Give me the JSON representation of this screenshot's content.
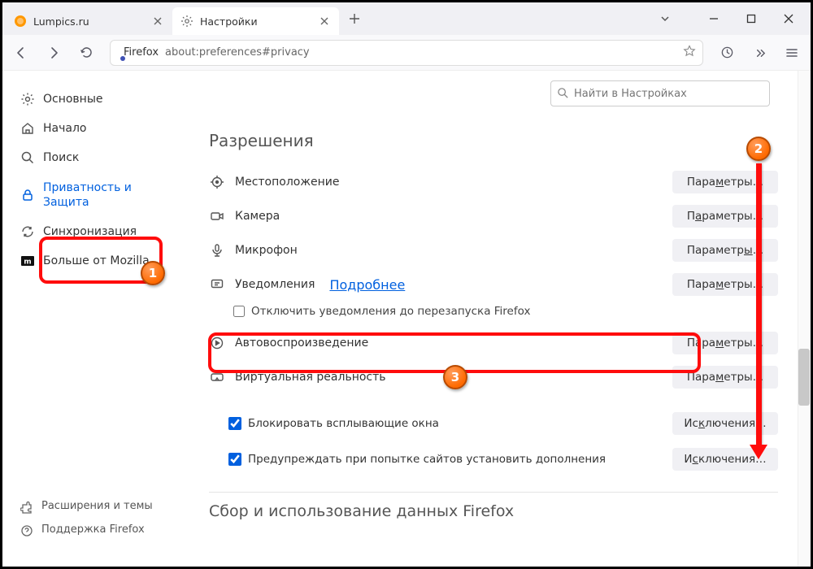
{
  "tabs": [
    {
      "title": "Lumpics.ru",
      "icon": "orange"
    },
    {
      "title": "Настройки",
      "icon": "gear"
    }
  ],
  "urlbar": {
    "brand": "Firefox",
    "address": "about:preferences#privacy"
  },
  "search": {
    "placeholder": "Найти в Настройках"
  },
  "sidebar": {
    "items": [
      {
        "label": "Основные"
      },
      {
        "label": "Начало"
      },
      {
        "label": "Поиск"
      },
      {
        "label": "Приватность и Защита"
      },
      {
        "label": "Синхронизация"
      },
      {
        "label": "Больше от Mozilla"
      }
    ],
    "bottom": [
      {
        "label": "Расширения и темы"
      },
      {
        "label": "Поддержка Firefox"
      }
    ]
  },
  "main": {
    "heading": "Разрешения",
    "perms": [
      {
        "label": "Местоположение",
        "button_pre": "Пара",
        "button_ul": "м",
        "button_post": "етры…"
      },
      {
        "label": "Камера",
        "button_pre": "П",
        "button_ul": "а",
        "button_post": "раметры…"
      },
      {
        "label": "Микрофон",
        "button_pre": "Параметр",
        "button_ul": "ы",
        "button_post": "…"
      },
      {
        "label": "Уведомления",
        "link": "Подробнее",
        "button_pre": "Пара",
        "button_ul": "м",
        "button_post": "етры…"
      },
      {
        "label": "Автовоспроизведение",
        "button_pre": "Пара",
        "button_ul": "м",
        "button_post": "етры…"
      },
      {
        "label": "Виртуальная реальность",
        "button_pre": "Пара",
        "button_ul": "м",
        "button_post": "етры…"
      }
    ],
    "notif_checkbox": "Отключить уведомления до перезапуска Firefox",
    "checks": [
      {
        "label": "Блокировать всплывающие окна",
        "button_pre": "Ис",
        "button_ul": "к",
        "button_post": "лючения…"
      },
      {
        "label": "Предупреждать при попытке сайтов установить дополнения",
        "button_pre": "И",
        "button_ul": "с",
        "button_post": "ключения…"
      }
    ],
    "next_heading": "Сбор и использование данных Firefox"
  },
  "annotations": {
    "b1": "1",
    "b2": "2",
    "b3": "3"
  }
}
